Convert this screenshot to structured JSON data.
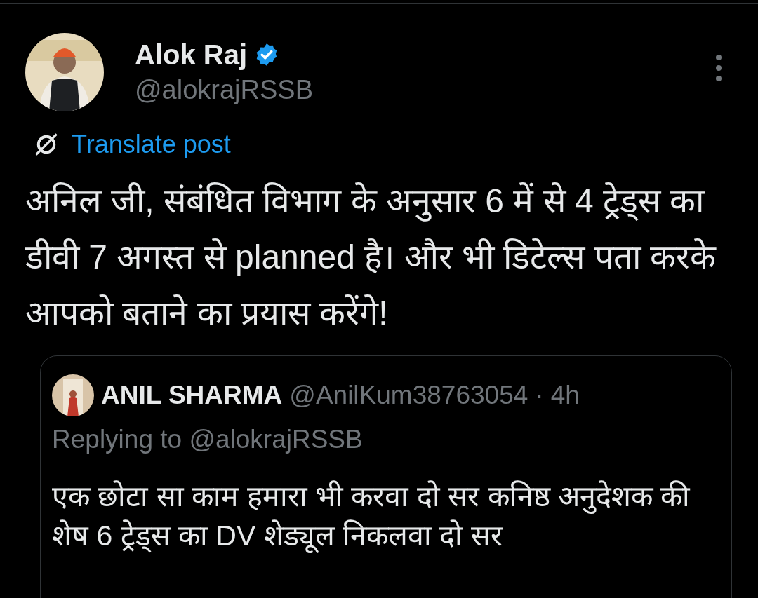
{
  "post": {
    "author": {
      "name": "Alok Raj",
      "verified": true,
      "handle": "@alokrajRSSB"
    },
    "translate": "Translate post",
    "text": "अनिल जी, संबंधित विभाग के अनुसार 6 में से 4 ट्रेड्स का डीवी 7 अगस्त से planned है। और भी डिटेल्स पता करके आपको बताने का प्रयास करेंगे!"
  },
  "quoted_post": {
    "author": {
      "name": "ANIL SHARMA",
      "handle": "@AnilKum38763054"
    },
    "separator": "·",
    "time": "4h",
    "replying_to": "Replying to @alokrajRSSB",
    "text": "एक छोटा सा काम हमारा भी करवा दो सर कनिष्ठ अनुदेशक की शेष 6 ट्रेड्स का DV शेड्यूल निकलवा दो सर"
  }
}
